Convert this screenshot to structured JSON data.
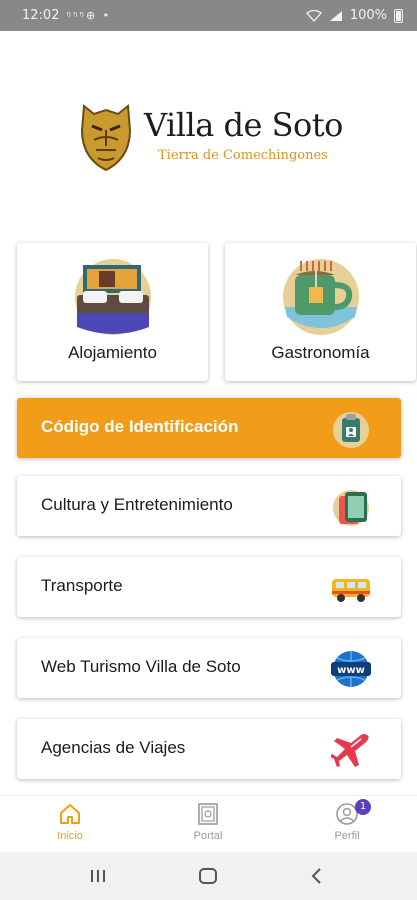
{
  "status_bar": {
    "time": "12:02",
    "battery": "100%"
  },
  "logo": {
    "title": "Villa de Soto",
    "subtitle": "Tierra de Comechingones"
  },
  "tiles": [
    {
      "label": "Alojamiento",
      "icon": "bed-icon"
    },
    {
      "label": "Gastronomía",
      "icon": "teacup-icon"
    }
  ],
  "rows": [
    {
      "label": "Código de Identificación",
      "icon": "id-badge-icon",
      "active": true
    },
    {
      "label": "Cultura y Entretenimiento",
      "icon": "phone-icon",
      "active": false
    },
    {
      "label": "Transporte",
      "icon": "bus-icon",
      "active": false
    },
    {
      "label": "Web Turismo Villa de Soto",
      "icon": "www-globe-icon",
      "active": false
    },
    {
      "label": "Agencias de Viajes",
      "icon": "airplane-icon",
      "active": false
    }
  ],
  "bottom_nav": {
    "items": [
      {
        "label": "Inicio",
        "icon": "home-icon",
        "active": true
      },
      {
        "label": "Portal",
        "icon": "portal-icon",
        "active": false
      },
      {
        "label": "Perfil",
        "icon": "profile-icon",
        "active": false,
        "badge": "1"
      }
    ]
  },
  "colors": {
    "accent": "#f29d1a",
    "status_bar": "#888888",
    "badge": "#5a3fc0"
  }
}
